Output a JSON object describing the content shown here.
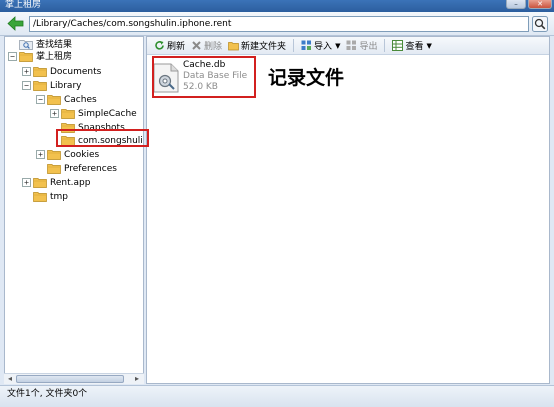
{
  "window": {
    "title": "掌上租房",
    "minimize_glyph": "–",
    "close_glyph": "✕"
  },
  "address_bar": {
    "path": "/Library/Caches/com.songshulin.iphone.rent"
  },
  "tree": {
    "items": [
      {
        "label": "查找结果",
        "depth": 0,
        "expander": "none",
        "icon": "search-folder-icon"
      },
      {
        "label": "掌上租房",
        "depth": 0,
        "expander": "minus",
        "icon": "folder-icon"
      },
      {
        "label": "Documents",
        "depth": 1,
        "expander": "plus",
        "icon": "folder-icon"
      },
      {
        "label": "Library",
        "depth": 1,
        "expander": "minus",
        "icon": "folder-icon"
      },
      {
        "label": "Caches",
        "depth": 2,
        "expander": "minus",
        "icon": "folder-icon"
      },
      {
        "label": "SimpleCache",
        "depth": 3,
        "expander": "plus",
        "icon": "folder-icon"
      },
      {
        "label": "Snapshots",
        "depth": 3,
        "expander": "none",
        "icon": "folder-icon"
      },
      {
        "label": "com.songshulin",
        "depth": 3,
        "expander": "none",
        "icon": "folder-icon",
        "selected": true
      },
      {
        "label": "Cookies",
        "depth": 2,
        "expander": "plus",
        "icon": "folder-icon"
      },
      {
        "label": "Preferences",
        "depth": 2,
        "expander": "none",
        "icon": "folder-icon"
      },
      {
        "label": "Rent.app",
        "depth": 1,
        "expander": "plus",
        "icon": "folder-icon"
      },
      {
        "label": "tmp",
        "depth": 1,
        "expander": "none",
        "icon": "folder-icon"
      }
    ]
  },
  "toolbar": {
    "refresh_label": "刷新",
    "delete_label": "删除",
    "new_folder_label": "新建文件夹",
    "import_label": "导入",
    "export_label": "导出",
    "view_label": "查看",
    "dropdown_glyph": "▼"
  },
  "files": [
    {
      "name": "Cache.db",
      "type": "Data Base File",
      "size": "52.0 KB",
      "icon": "database-file-icon"
    }
  ],
  "annotation": {
    "text": "记录文件",
    "color": "#d2201f"
  },
  "status_bar": {
    "text": "文件1个, 文件夹0个"
  },
  "scrollbar": {
    "left_arrow": "◂",
    "right_arrow": "▸"
  },
  "colors": {
    "folder": "#f2c14e",
    "highlight_box": "#d2201f",
    "back_arrow": "#3aa53a"
  }
}
